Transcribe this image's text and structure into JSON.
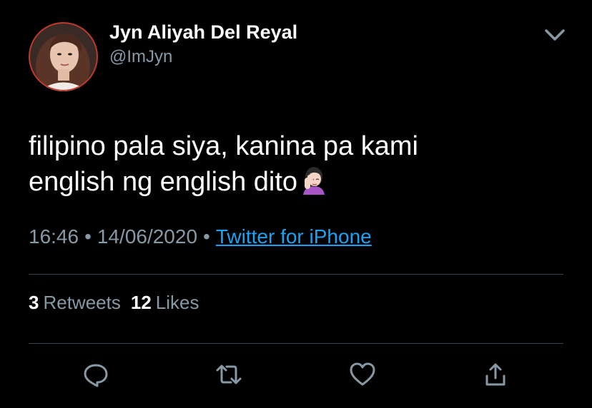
{
  "tweet": {
    "author": {
      "display_name": "Jyn Aliyah Del Reyal",
      "handle": "@ImJyn"
    },
    "text_lines": [
      "filipino pala siya, kanina pa kami",
      "english ng english dito"
    ],
    "emoji": "face-palm-woman-emoji",
    "time": "16:46",
    "separator": "•",
    "date": "14/06/2020",
    "source": "Twitter for iPhone",
    "stats": {
      "retweets_count": "3",
      "retweets_label": "Retweets",
      "likes_count": "12",
      "likes_label": "Likes"
    },
    "actions": [
      "reply-icon",
      "retweet-icon",
      "like-icon",
      "share-icon"
    ]
  },
  "colors": {
    "background": "#000000",
    "primary_text": "#ffffff",
    "secondary_text": "#8899a6",
    "link": "#1da1f2",
    "divider": "#38444d"
  }
}
